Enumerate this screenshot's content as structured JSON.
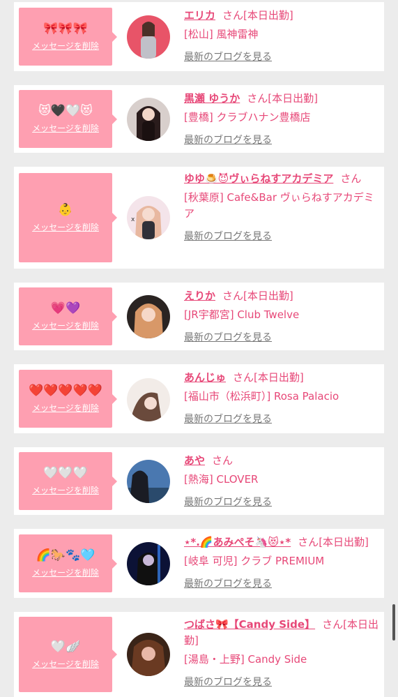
{
  "favorites": [
    {
      "emoji": "🎀🎀🎀",
      "delete_label": "メッセージを削除",
      "name": "エリカ",
      "honorific": "さん",
      "status": "[本日出勤]",
      "shop": "[松山] 風神雷神",
      "blog_label": "最新のブログを見る",
      "avatar_color": "#d04050"
    },
    {
      "emoji": "😻🖤🤍😻",
      "delete_label": "メッセージを削除",
      "name": "黒瀬 ゆうか",
      "honorific": "さん",
      "status": "[本日出勤]",
      "shop": "[豊橋] クラブハナン豊橋店",
      "blog_label": "最新のブログを見る",
      "avatar_color": "#3a2a2c"
    },
    {
      "emoji": "👶",
      "delete_label": "メッセージを削除",
      "name": "ゆゆ🍮😈ヴぃらねすアカデミア",
      "honorific": "さん",
      "status": "",
      "shop": "[秋葉原] Cafe&Bar ヴぃらねすアカデミア",
      "blog_label": "最新のブログを見る",
      "avatar_color": "#e8d0d8"
    },
    {
      "emoji": "💗💜",
      "delete_label": "メッセージを削除",
      "name": "えりか",
      "honorific": "さん",
      "status": "[本日出勤]",
      "shop": "[JR宇都宮] Club Twelve",
      "blog_label": "最新のブログを見る",
      "avatar_color": "#c89070"
    },
    {
      "emoji": "❤️❤️❤️❤️❤️",
      "delete_label": "メッセージを削除",
      "name": "あんじゅ",
      "honorific": "さん",
      "status": "[本日出勤]",
      "shop": "[福山市（松浜町）] Rosa Palacio",
      "blog_label": "最新のブログを見る",
      "avatar_color": "#e0c8c0"
    },
    {
      "emoji": "🤍🤍🤍",
      "delete_label": "メッセージを削除",
      "name": "あや",
      "honorific": "さん",
      "status": "",
      "shop": "[熱海] CLOVER",
      "blog_label": "最新のブログを見る",
      "avatar_color": "#3a5a80"
    },
    {
      "emoji": "🌈🐎🐾🩵",
      "delete_label": "メッセージを削除",
      "name": "⋆*.🌈あみぺそ🦄😻⋆*",
      "honorific": "さん",
      "status": "[本日出勤]",
      "shop": "[岐阜 可児] クラブ PREMIUM",
      "blog_label": "最新のブログを見る",
      "avatar_color": "#14204a"
    },
    {
      "emoji": "🤍🪽",
      "delete_label": "メッセージを削除",
      "name": "つばさ🎀【Candy Side】",
      "honorific": "さん",
      "status": "[本日出勤]",
      "shop": "[湯島・上野] Candy Side",
      "blog_label": "最新のブログを見る",
      "avatar_color": "#5a3020"
    }
  ]
}
